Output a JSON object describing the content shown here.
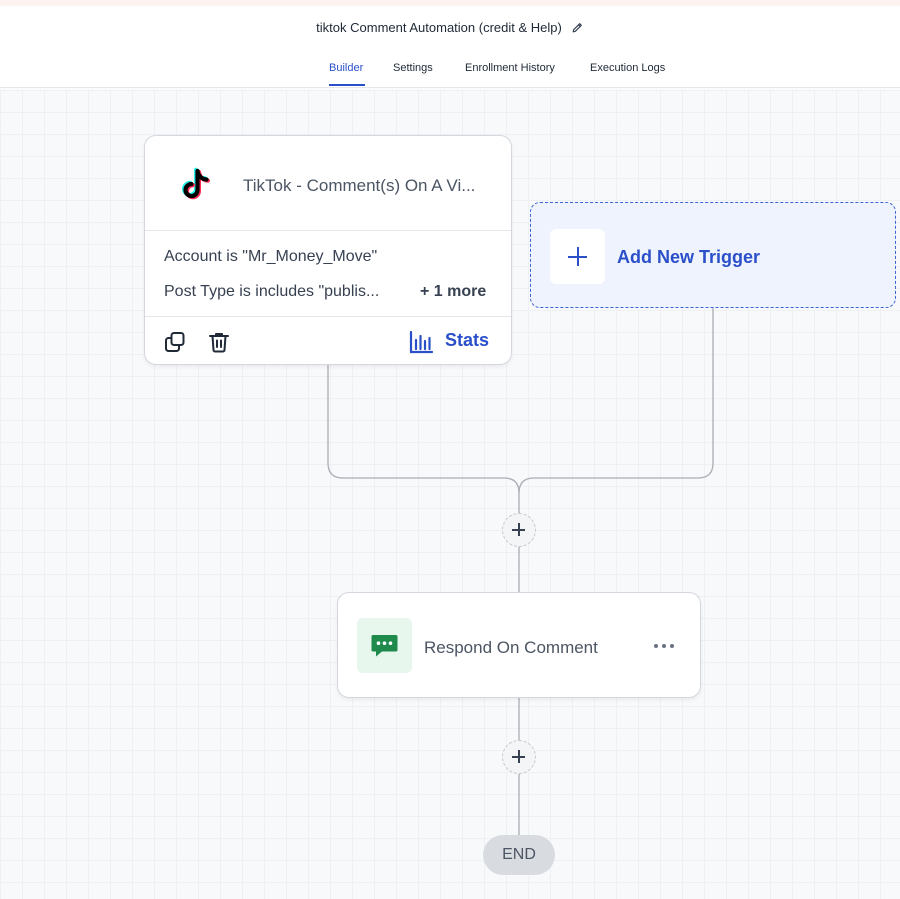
{
  "header": {
    "title": "tiktok Comment Automation (credit & Help)"
  },
  "tabs": [
    {
      "label": "Builder",
      "active": true
    },
    {
      "label": "Settings",
      "active": false
    },
    {
      "label": "Enrollment History",
      "active": false
    },
    {
      "label": "Execution Logs",
      "active": false
    }
  ],
  "trigger": {
    "title": "TikTok - Comment(s) On A Vi...",
    "conditions": [
      "Account is \"Mr_Money_Move\"",
      "Post Type is includes \"publis..."
    ],
    "more_label": "+ 1 more",
    "stats_label": "Stats",
    "icons": [
      "tiktok-logo",
      "copy-icon",
      "trash-icon",
      "bar-chart-icon"
    ]
  },
  "add_trigger": {
    "label": "Add New Trigger",
    "icon": "plus-icon"
  },
  "action": {
    "title": "Respond On Comment",
    "icons": [
      "chat-bubble-icon",
      "more-options-icon"
    ]
  },
  "end_label": "END",
  "colors": {
    "accent": "#2b4fc9",
    "action_icon_bg": "#e8f7ee",
    "action_icon_fg": "#1e8a4c",
    "card_border": "#d4d8de",
    "end_pill_bg": "#d8dbe0"
  }
}
